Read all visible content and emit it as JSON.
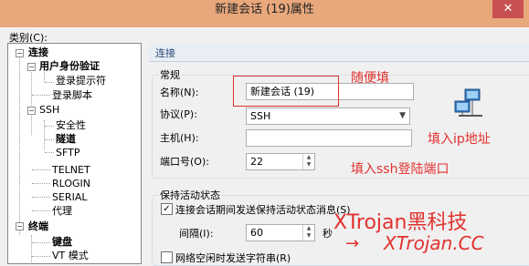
{
  "window": {
    "title": "新建会话 (19)属性",
    "close_glyph": "✕"
  },
  "category_label": "类别(C):",
  "tree": [
    {
      "label": "连接",
      "bold": true
    },
    {
      "label": "用户身份验证",
      "bold": true
    },
    {
      "label": "登录提示符",
      "bold": false
    },
    {
      "label": "登录脚本",
      "bold": false
    },
    {
      "label": "SSH",
      "bold": false
    },
    {
      "label": "安全性",
      "bold": false
    },
    {
      "label": "隧道",
      "bold": true
    },
    {
      "label": "SFTP",
      "bold": false
    },
    {
      "label": "TELNET",
      "bold": false
    },
    {
      "label": "RLOGIN",
      "bold": false
    },
    {
      "label": "SERIAL",
      "bold": false
    },
    {
      "label": "代理",
      "bold": false
    },
    {
      "label": "终端",
      "bold": true
    },
    {
      "label": "键盘",
      "bold": true
    },
    {
      "label": "VT 模式",
      "bold": false
    }
  ],
  "section_title": "连接",
  "general": {
    "legend": "常规",
    "name_label": "名称(N):",
    "name_value": "新建会话 (19)",
    "protocol_label": "协议(P):",
    "protocol_value": "SSH",
    "host_label": "主机(H):",
    "host_value": "",
    "port_label": "端口号(O):",
    "port_value": "22"
  },
  "keepalive": {
    "legend": "保持活动状态",
    "send_keepalive_label": "连接会话期间发送保持活动状态消息(S)",
    "send_keepalive_checked": true,
    "interval_label": "间隔(I):",
    "interval_value": "60",
    "interval_unit": "秒",
    "idle_string_label": "网络空闲时发送字符串(R)",
    "idle_string_checked": false
  },
  "annotations": {
    "name_hint": "随便填",
    "host_hint": "填入ip地址",
    "port_hint": "填入ssh登陆端口"
  },
  "watermark": {
    "brand": "XTrojan黑科技",
    "arrow": "→",
    "site": "XTrojan.CC"
  },
  "colors": {
    "annotation": "#e2312e",
    "titlebar": "#e8a87c"
  },
  "icons": {
    "network": "network-computers-icon"
  }
}
